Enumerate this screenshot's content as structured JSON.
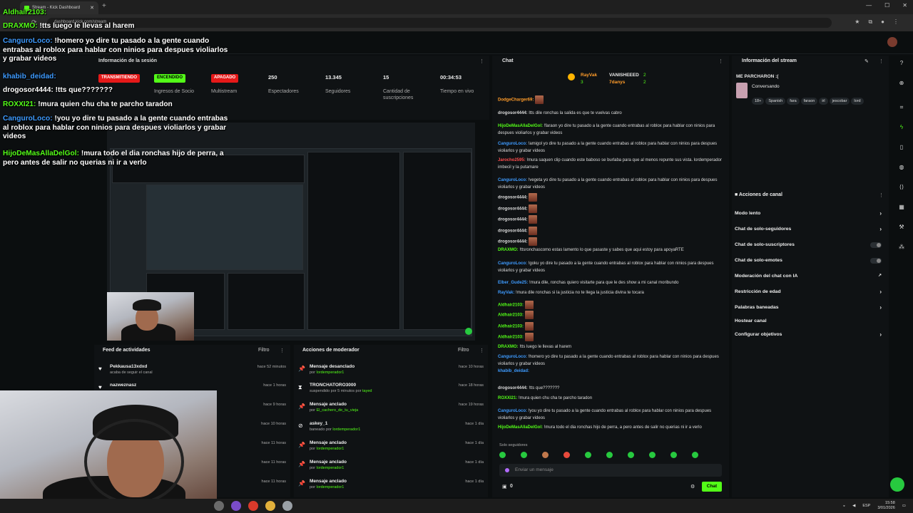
{
  "browser": {
    "tab_title": "Stream - Kick Dashboard",
    "url": "dashboard.kick.com/stream"
  },
  "session": {
    "header": "Información de la sesión",
    "badges": [
      {
        "label": "TRANSMITIENDO",
        "desc": "",
        "color": "#e61919"
      },
      {
        "label": "ENCENDIDO",
        "desc": "Ingresos de Socio",
        "color": "#53fc18"
      },
      {
        "label": "APAGADO",
        "desc": "Multistream",
        "color": "#e61919"
      }
    ],
    "stats": [
      {
        "value": "250",
        "label": "Espectadores"
      },
      {
        "value": "13.345",
        "label": "Seguidores"
      },
      {
        "value": "15",
        "label": "Cantidad de suscripciones"
      },
      {
        "value": "00:34:53",
        "label": "Tiempo en vivo"
      }
    ]
  },
  "feed": {
    "title": "Feed de actividades",
    "filter": "Filtro",
    "rows": [
      {
        "name": "Pekkausa13xdxd",
        "sub": "acaba de seguir el canal",
        "time": "hace 52 minutos"
      },
      {
        "name": "nazweznasz",
        "sub": "",
        "time": "hace 1 horas"
      },
      {
        "name": "",
        "sub": "",
        "time": "hace 9 horas"
      },
      {
        "name": "",
        "sub": "",
        "time": "hace 10 horas"
      },
      {
        "name": "",
        "sub": "",
        "time": "hace 11 horas"
      },
      {
        "name": "",
        "sub": "",
        "time": "hace 11 horas"
      },
      {
        "name": "",
        "sub": "",
        "time": "hace 11 horas"
      }
    ]
  },
  "mod": {
    "title": "Acciones de moderador",
    "filter": "Filtro",
    "rows": [
      {
        "icon": "pin",
        "name": "Mensaje desanclado",
        "sub_prefix": "por ",
        "user": "lordemperador1",
        "time": "hace 10 horas"
      },
      {
        "icon": "hourglass",
        "name": "TRONCHATORO3000",
        "sub_prefix": "suspendido por 5 minutos por ",
        "user": "tayed",
        "time": "hace 18 horas"
      },
      {
        "icon": "pin",
        "name": "Mensaje anclado",
        "sub_prefix": "por ",
        "user": "El_cachero_de_tu_vieja",
        "time": "hace 19 horas"
      },
      {
        "icon": "ban",
        "name": "askey_1",
        "sub_prefix": "baneado por ",
        "user": "lordemperador1",
        "time": "hace 1 día"
      },
      {
        "icon": "pin",
        "name": "Mensaje anclado",
        "sub_prefix": "por ",
        "user": "lordemperador1",
        "time": "hace 1 día"
      },
      {
        "icon": "pin",
        "name": "Mensaje anclado",
        "sub_prefix": "por ",
        "user": "lordemperador1",
        "time": "hace 1 día"
      },
      {
        "icon": "pin",
        "name": "Mensaje anclado",
        "sub_prefix": "por ",
        "user": "lordemperador1",
        "time": "hace 1 día"
      }
    ]
  },
  "chat": {
    "title": "Chat",
    "pinned_top": [
      {
        "name": "RayVak",
        "count": "3"
      },
      {
        "name": "VANISHEEED",
        "count": "2"
      },
      {
        "name": "7danys",
        "count": "2"
      }
    ],
    "messages": [
      {
        "user": "DodgeCharger69:",
        "color": "#ff9c2a",
        "text": "",
        "emote": true
      },
      {
        "user": "drogosor4444:",
        "color": "#dddddd",
        "text": "ltts dile ronchas la salida es que te vuelvas cabro"
      },
      {
        "user": "HijoDeMasAllaDelGol:",
        "color": "#53fc18",
        "text": "!faraon yo dire tu pasado a la gente cuando entrabas al roblox para hablar con ninios para despues violiarlos y grabar videos"
      },
      {
        "user": "CanguroLoco:",
        "color": "#3e9bff",
        "text": "!amigol yo dire tu pasado a la gente cuando entrabas al roblox para hablar con ninios para despues violiarlos y grabar videos"
      },
      {
        "user": "Jarocho2595:",
        "color": "#ff4d4d",
        "text": "!mura saquen clip cuando este baboso se burlaba para que al menos repunte sus vista. lordemperador imbecil y la putamare"
      },
      {
        "user": "CanguroLoco:",
        "color": "#3e9bff",
        "text": "!vegeta yo dire tu pasado a la gente cuando entrabas al roblox para hablar con ninios para despues violiarlos y grabar videos"
      },
      {
        "user": "drogosor4444:",
        "color": "#dddddd",
        "text": "",
        "emote": true
      },
      {
        "user": "drogosor4444:",
        "color": "#dddddd",
        "text": "",
        "emote": true
      },
      {
        "user": "drogosor4444:",
        "color": "#dddddd",
        "text": "",
        "emote": true
      },
      {
        "user": "drogosor4444:",
        "color": "#dddddd",
        "text": "",
        "emote": true
      },
      {
        "user": "drogosor4444:",
        "color": "#dddddd",
        "text": "",
        "emote": true
      },
      {
        "user": "DRAXMO:",
        "color": "#53fc18",
        "text": "!ttsronchascomo estas lamento lo que pasaste y sabes que aqui estoy para apoyaRTE"
      },
      {
        "user": "CanguroLoco:",
        "color": "#3e9bff",
        "text": "!goku yo dire tu pasado a la gente cuando entrabas al roblox para hablar con ninios para despues violiarlos y grabar videos"
      },
      {
        "user": "Elber_Gude25:",
        "color": "#3e9bff",
        "text": "!mura dile, ronchas quiero visitarte para que le des show a mi canal moribundo"
      },
      {
        "user": "RayVak:",
        "color": "#3e9bff",
        "text": "!mura dile ronchas si la justicia no te llega la justicia divina te tocara"
      },
      {
        "user": "Aldhair2103:",
        "color": "#53fc18",
        "text": "",
        "emote": true
      },
      {
        "user": "Aldhair2103:",
        "color": "#53fc18",
        "text": "",
        "emote": true
      },
      {
        "user": "Aldhair2103:",
        "color": "#53fc18",
        "text": "",
        "emote": true
      },
      {
        "user": "Aldhair2103:",
        "color": "#53fc18",
        "text": "",
        "emote": true
      },
      {
        "user": "DRAXMO:",
        "color": "#53fc18",
        "text": "!tts luego le llevas al harem"
      },
      {
        "user": "CanguroLoco:",
        "color": "#3e9bff",
        "text": "!homero yo dire tu pasado a la gente cuando entrabas al roblox para hablar con ninios para despues violiarlos y grabar videos"
      },
      {
        "user": "khabib_deidad:",
        "color": "#3e9bff",
        "text": ""
      },
      {
        "user": "drogosor4444:",
        "color": "#dddddd",
        "text": "!tts que???????"
      },
      {
        "user": "ROXXI21:",
        "color": "#53fc18",
        "text": "!mura quien chu cha te parcho taradon"
      },
      {
        "user": "CanguroLoco:",
        "color": "#3e9bff",
        "text": "!you yo dire tu pasado a la gente cuando entrabas al roblox para hablar con ninios para despues violiarlos y grabar videos"
      },
      {
        "user": "HijoDeMasAllaDelGol:",
        "color": "#53fc18",
        "text": "!mura todo el dia ronchas hijo de perra, a pero antes de salir no querias ni ir a verlo"
      }
    ],
    "followers_only": "Solo seguidores",
    "input_placeholder": "Enviar un mensaje",
    "points": "0",
    "send_label": "Chat"
  },
  "info": {
    "title": "Información del stream",
    "stream_title": "ME PARCHARON :(",
    "category": "Conversando",
    "tags": [
      "18+",
      "Spanish",
      "fara",
      "faraon",
      "irl",
      "jescobar",
      "lord"
    ]
  },
  "actions": {
    "title": "Acciones de canal",
    "items": [
      {
        "label": "Modo lento",
        "kind": "chevron"
      },
      {
        "label": "Chat de solo-seguidores",
        "kind": "chevron"
      },
      {
        "label": "Chat de solo-suscriptores",
        "kind": "toggle"
      },
      {
        "label": "Chat de solo-emotes",
        "kind": "toggle"
      },
      {
        "label": "Moderación del chat con IA",
        "kind": "external"
      },
      {
        "label": "Restricción de edad",
        "kind": "chevron"
      },
      {
        "label": "Palabras baneadas",
        "kind": "chevron"
      },
      {
        "label": "Hostear canal",
        "kind": "none"
      },
      {
        "label": "Configurar objetivos",
        "kind": "chevron"
      }
    ]
  },
  "overlay": [
    {
      "user": "Aldhair2103:",
      "text": ""
    },
    {
      "user": "DRAXMO:",
      "text": " !tts luego le llevas al harem"
    },
    {
      "user": "CanguroLoco:",
      "text": " !homero yo dire tu pasado a la gente cuando entrabas al roblox para hablar con ninios para despues violiarlos y grabar videos"
    },
    {
      "user": "khabib_deidad:",
      "text": ""
    },
    {
      "user": "drogosor4444:",
      "text": " !tts que???????"
    },
    {
      "user": "ROXXI21:",
      "text": " !mura quien chu cha te parcho taradon"
    },
    {
      "user": "CanguroLoco:",
      "text": " !you yo dire tu pasado a la gente cuando entrabas al roblox para hablar con ninios para despues violiarlos y grabar videos"
    },
    {
      "user": "HijoDeMasAllaDelGol:",
      "text": " !mura todo el dia ronchas hijo de perra, a pero antes de salir no querias ni ir a verlo"
    }
  ],
  "taskbar": {
    "lang": "ESP",
    "time": "15:58",
    "date": "3/01/2026"
  },
  "colors": {
    "accent": "#53fc18",
    "live": "#e61919"
  }
}
